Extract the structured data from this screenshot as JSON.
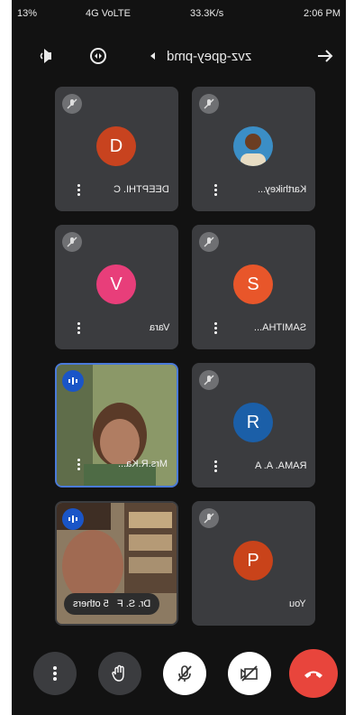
{
  "status_bar": {
    "time": "2:06 PM",
    "speed": "33.3K/s",
    "network": "4G VoLTE",
    "battery": "13%"
  },
  "header": {
    "meeting_code": "zvz-gpey-pmd"
  },
  "participants": [
    {
      "name": "Karthikey...",
      "avatar_type": "photo",
      "muted": true
    },
    {
      "name": "DEEPTHI. C",
      "initial": "D",
      "color": "#c8431f",
      "muted": true
    },
    {
      "name": "SAMITHA...",
      "initial": "S",
      "color": "#e8562a",
      "muted": true
    },
    {
      "name": "Vara",
      "initial": "V",
      "color": "#e83e7a",
      "muted": true
    },
    {
      "name": "RAMA. A. A",
      "initial": "R",
      "color": "#1b5fa8",
      "muted": true
    },
    {
      "name": "Mrs.R.Ka...",
      "avatar_type": "video",
      "speaking": true
    },
    {
      "name": "You",
      "initial": "P",
      "color": "#c9431a",
      "muted": true
    },
    {
      "name": "Dr. S. F",
      "avatar_type": "video",
      "speaking": true,
      "others_label": "5 others"
    }
  ],
  "controls": {
    "more": "more-options",
    "raise_hand": "raise-hand",
    "mic": "mic-off",
    "camera": "camera-off",
    "end_call": "end-call"
  }
}
